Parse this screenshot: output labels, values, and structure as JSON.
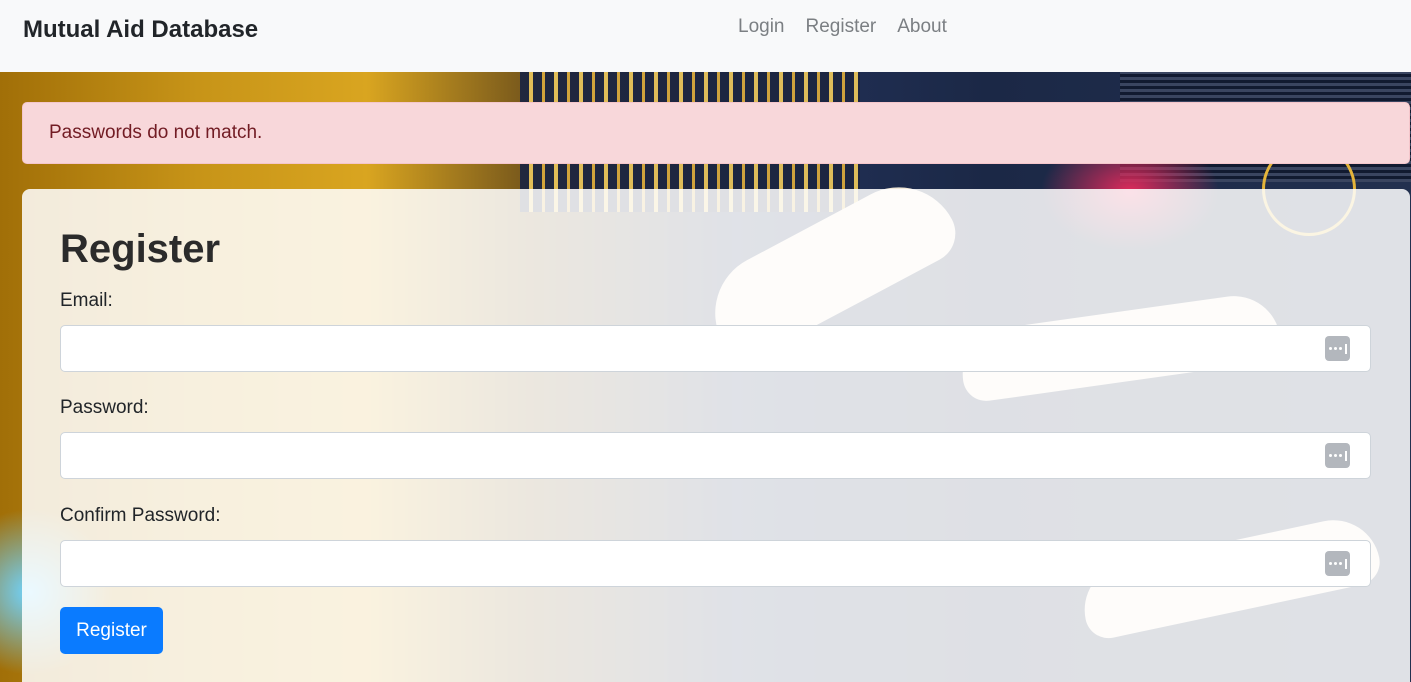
{
  "navbar": {
    "brand": "Mutual Aid Database",
    "links": [
      {
        "label": "Login"
      },
      {
        "label": "Register"
      },
      {
        "label": "About"
      }
    ]
  },
  "alert": {
    "message": "Passwords do not match.",
    "color_bg": "#f8d7da",
    "color_text": "#721c24"
  },
  "form": {
    "title": "Register",
    "fields": [
      {
        "label": "Email:",
        "value": "",
        "icon": "password-manager-icon"
      },
      {
        "label": "Password:",
        "value": "",
        "icon": "password-manager-icon"
      },
      {
        "label": "Confirm Password:",
        "value": "",
        "icon": "password-manager-icon"
      }
    ],
    "submit_label": "Register",
    "accent": "#0a7bff"
  }
}
